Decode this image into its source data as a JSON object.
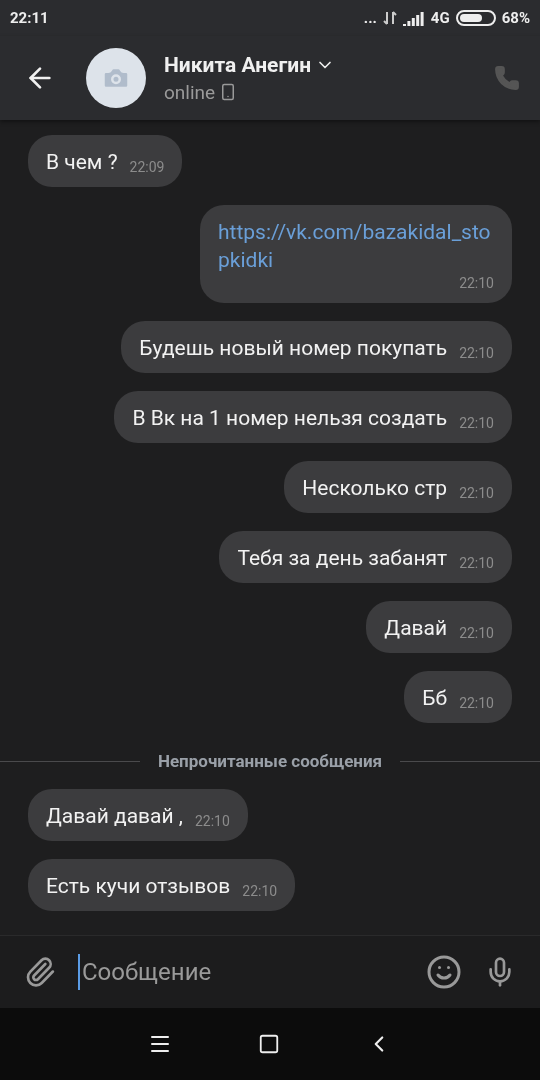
{
  "status_bar": {
    "time": "22:11",
    "dots": "...",
    "network": "4G",
    "battery": "68%"
  },
  "header": {
    "name": "Никита Анегин",
    "status": "online"
  },
  "messages": [
    {
      "kind": "incoming",
      "text": "В чем ?",
      "time": "22:09"
    },
    {
      "kind": "outgoing",
      "text": "https://vk.com/bazakidal_stopkidki",
      "time": "22:10",
      "link": true
    },
    {
      "kind": "outgoing",
      "text": "Будешь новый номер покупать",
      "time": "22:10"
    },
    {
      "kind": "outgoing",
      "text": "В Вк на 1 номер нельзя  создать",
      "time": "22:10"
    },
    {
      "kind": "outgoing",
      "text": "Несколько стр",
      "time": "22:10"
    },
    {
      "kind": "outgoing",
      "text": "Тебя за день забанят",
      "time": "22:10"
    },
    {
      "kind": "outgoing",
      "text": "Давай",
      "time": "22:10"
    },
    {
      "kind": "outgoing",
      "text": "Бб",
      "time": "22:10"
    },
    {
      "kind": "divider",
      "text": "Непрочитанные сообщения"
    },
    {
      "kind": "incoming",
      "text": "Давай давай ,",
      "time": "22:10"
    },
    {
      "kind": "incoming",
      "text": "Есть кучи отзывов",
      "time": "22:10"
    }
  ],
  "composer": {
    "placeholder": "Сообщение"
  }
}
